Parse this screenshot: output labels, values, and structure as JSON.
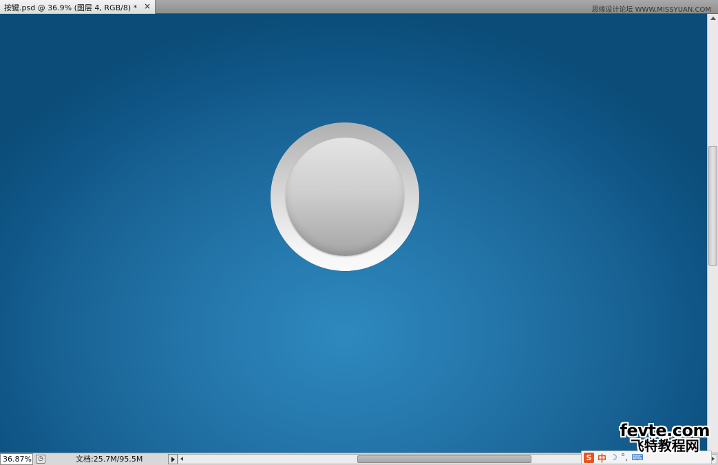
{
  "tab": {
    "title": "按键.psd @ 36.9% (图层 4, RGB/8) *",
    "close": "×"
  },
  "watermark_top": "思缘设计论坛 WWW.MISSYUAN.COM",
  "canvas": {
    "accent_center": "#2e89bf",
    "accent_edge": "#0b4c78",
    "button_ring_top": "#b0b0b0",
    "button_ring_bottom": "#fafafa",
    "button_face_top": "#e4e4e4",
    "button_face_bottom": "#a6a6a6"
  },
  "status": {
    "zoom": "36.87%",
    "doc_info": "文档:25.7M/95.5M"
  },
  "ime": {
    "logo": "S",
    "mode": "中",
    "moon": "☽",
    "dot": "°,",
    "keyboard": "⌨"
  },
  "watermark_bottom": {
    "line1": "fevte.com",
    "line2": "飞特教程网"
  }
}
